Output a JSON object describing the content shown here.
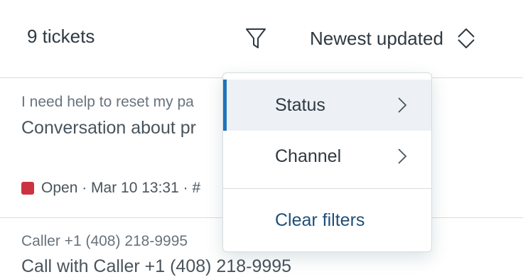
{
  "header": {
    "ticket_count": "9 tickets",
    "filter_icon": "filter-icon",
    "sort_label": "Newest updated",
    "sort_icon": "sort-up-down-icon"
  },
  "tickets": [
    {
      "subject": "I need help to reset my pa",
      "title": "Conversation about pr",
      "status": "Open",
      "status_color": "#cc3340",
      "meta": " · Mar 10 13:31 · #"
    },
    {
      "subject": "Caller +1 (408) 218-9995",
      "title": "Call with Caller +1 (408) 218-9995"
    }
  ],
  "filter_menu": {
    "items": [
      {
        "label": "Status",
        "icon": "chevron-right-icon",
        "active": true
      },
      {
        "label": "Channel",
        "icon": "chevron-right-icon",
        "active": false
      }
    ],
    "clear_label": "Clear filters"
  },
  "colors": {
    "accent": "#1f73b7",
    "active_bg": "#edf1f6",
    "link": "#1f4f7a",
    "border": "#d8dcde"
  }
}
